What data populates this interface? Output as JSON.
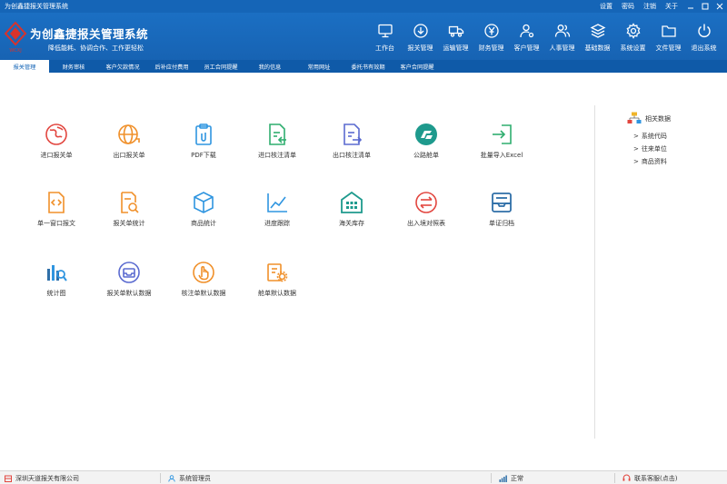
{
  "window": {
    "title": "为创鑫捷报关管理系统",
    "links": [
      "设置",
      "密码",
      "注销",
      "关于"
    ]
  },
  "brand": {
    "title": "为创鑫捷报关管理系统",
    "slogan": "降低能耗、协调合作、工作更轻松",
    "logo_text": "WCXJ"
  },
  "modules": [
    {
      "label": "工作台",
      "icon": "monitor-icon"
    },
    {
      "label": "报关管理",
      "icon": "download-circle-icon"
    },
    {
      "label": "运输管理",
      "icon": "truck-icon"
    },
    {
      "label": "财务管理",
      "icon": "yen-icon"
    },
    {
      "label": "客户管理",
      "icon": "user-gear-icon"
    },
    {
      "label": "人事管理",
      "icon": "people-icon"
    },
    {
      "label": "基础数据",
      "icon": "layers-icon"
    },
    {
      "label": "系统设置",
      "icon": "gear-icon"
    },
    {
      "label": "文件管理",
      "icon": "folder-icon"
    },
    {
      "label": "退出系统",
      "icon": "power-icon"
    }
  ],
  "tabs": [
    "报关管理",
    "财务审核",
    "客户欠款情况",
    "后补应付费用",
    "员工合同提醒",
    "我的信息",
    "常用网址",
    "委托书有效期",
    "客户合同提醒"
  ],
  "grid": [
    {
      "label": "进口报关单",
      "icon": "globe-in-icon"
    },
    {
      "label": "出口报关单",
      "icon": "globe-out-icon"
    },
    {
      "label": "PDF下载",
      "icon": "clipboard-icon"
    },
    {
      "label": "进口核注清单",
      "icon": "doc-import-icon"
    },
    {
      "label": "出口核注清单",
      "icon": "doc-export-icon"
    },
    {
      "label": "公路舱单",
      "icon": "road-icon"
    },
    {
      "label": "批量导入Excel",
      "icon": "import-icon"
    },
    {
      "label": "单一窗口报文",
      "icon": "code-file-icon"
    },
    {
      "label": "报关单统计",
      "icon": "search-doc-icon"
    },
    {
      "label": "商品统计",
      "icon": "box-icon"
    },
    {
      "label": "进度跟踪",
      "icon": "line-chart-icon"
    },
    {
      "label": "海关库存",
      "icon": "warehouse-icon"
    },
    {
      "label": "出入境对照表",
      "icon": "swap-icon"
    },
    {
      "label": "单证归档",
      "icon": "archive-icon"
    },
    {
      "label": "统计图",
      "icon": "bar-chart-icon"
    },
    {
      "label": "报关单默认数据",
      "icon": "tray-icon"
    },
    {
      "label": "核注单默认数据",
      "icon": "hand-icon"
    },
    {
      "label": "舱单默认数据",
      "icon": "doc-gear-icon"
    }
  ],
  "side": {
    "title": "相关数据",
    "arrow": ">",
    "links": [
      "系统代码",
      "往来单位",
      "商品资料"
    ]
  },
  "status": {
    "company": "深圳天道报关有限公司",
    "user": "系统管理员",
    "state": "正常",
    "support": "联系客服(点击)"
  },
  "colors": {
    "header": "#1b6fc3",
    "tabbar": "#0f5aa8",
    "red": "#e2463f",
    "orange": "#f0902a",
    "blue": "#2f95e0",
    "green": "#2fae6f",
    "teal": "#1e9a8d",
    "purple": "#5b6bd0"
  }
}
